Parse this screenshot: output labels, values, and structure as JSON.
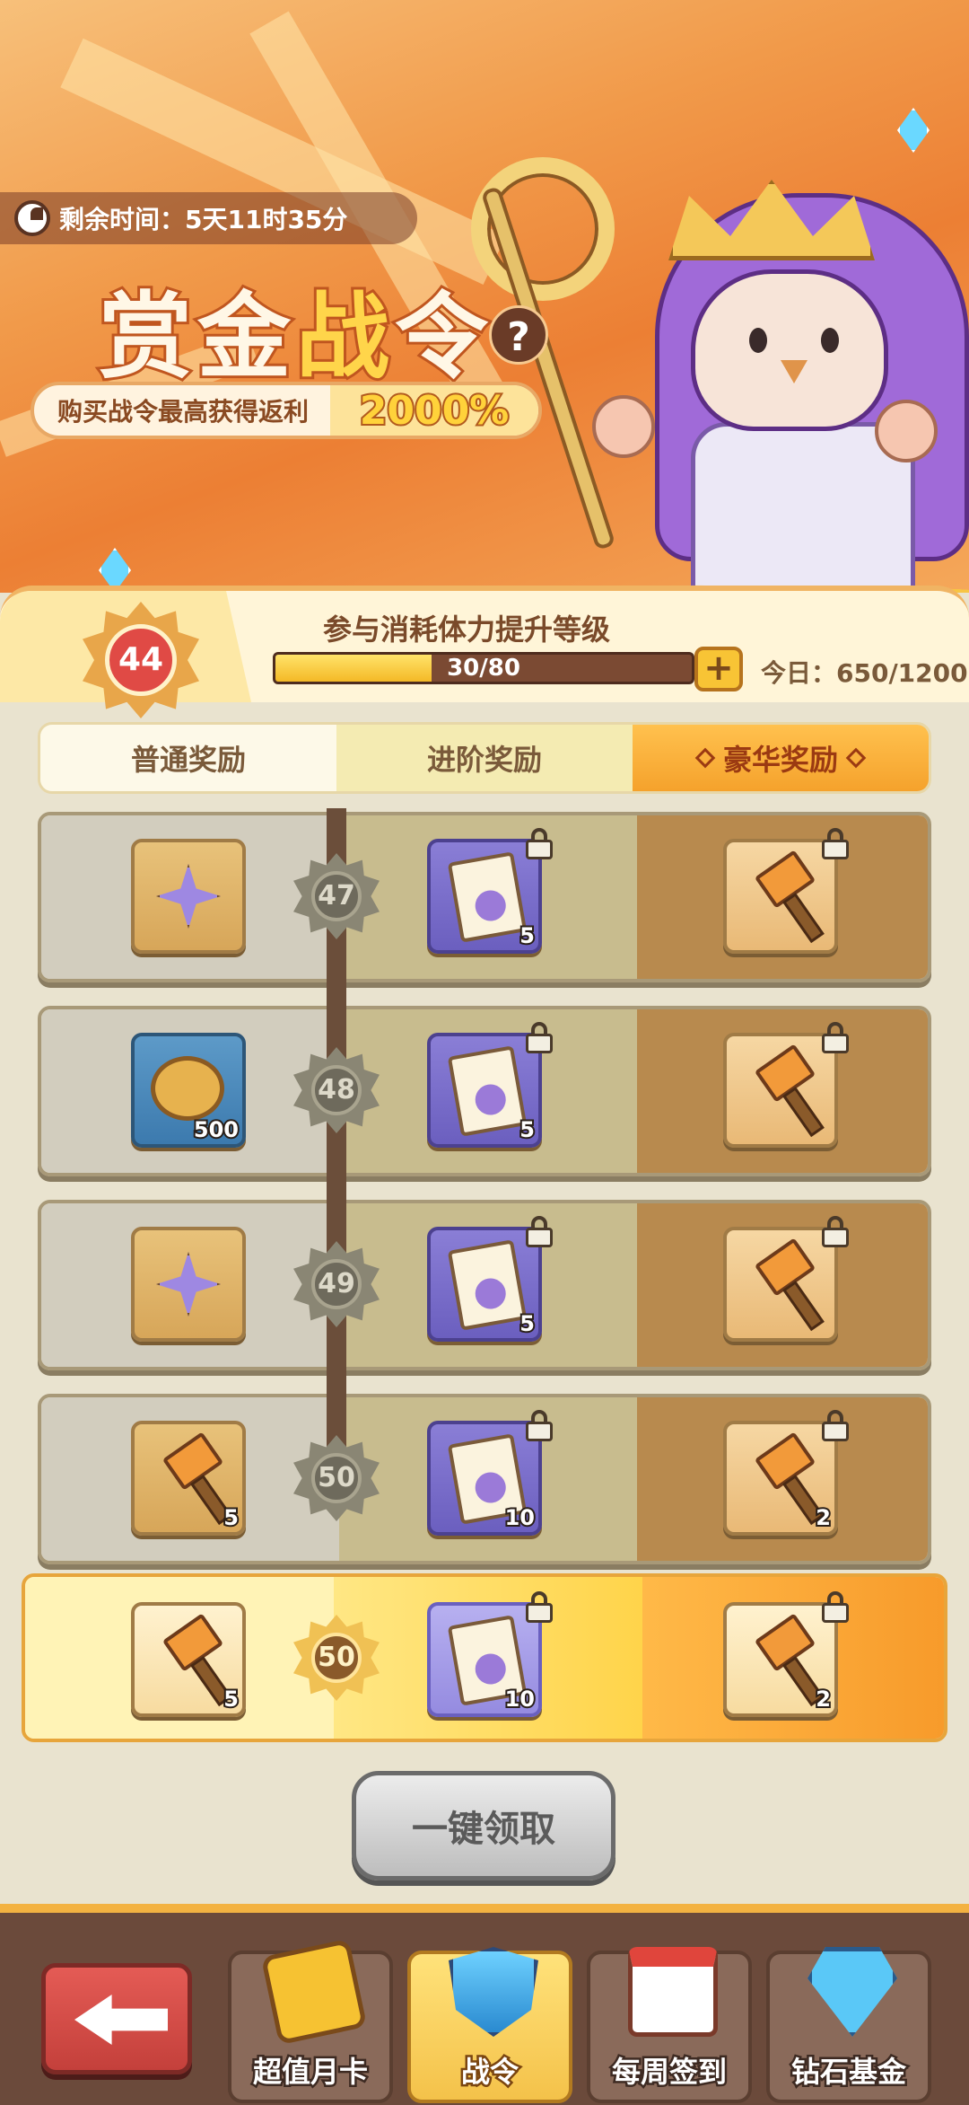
{
  "banner": {
    "timer_label": "剩余时间：5天11时35分",
    "title_part1": "赏金",
    "title_part2": "战",
    "title_part3": "令",
    "help_icon": "?",
    "promo_text": "购买战令最高获得返利",
    "promo_value": "2000%"
  },
  "level": {
    "current": "44",
    "hint": "参与消耗体力提升等级",
    "progress_text": "30/80",
    "progress_fraction": 0.375,
    "plus_label": "+",
    "today_text": "今日：650/1200"
  },
  "tabs": [
    {
      "label": "普通奖励"
    },
    {
      "label": "进阶奖励"
    },
    {
      "label": "豪华奖励"
    }
  ],
  "rows": [
    {
      "level": "47",
      "normal": {
        "icon": "star-crystal-icon",
        "count": ""
      },
      "advanced": {
        "icon": "integral-book-icon",
        "count": "5"
      },
      "deluxe": {
        "icon": "hammer-icon",
        "count": ""
      }
    },
    {
      "level": "48",
      "normal": {
        "icon": "gold-coin-icon",
        "count": "500"
      },
      "advanced": {
        "icon": "integral-book-icon",
        "count": "5"
      },
      "deluxe": {
        "icon": "hammer-icon",
        "count": ""
      }
    },
    {
      "level": "49",
      "normal": {
        "icon": "star-crystal-icon",
        "count": ""
      },
      "advanced": {
        "icon": "integral-book-icon",
        "count": "5"
      },
      "deluxe": {
        "icon": "hammer-icon",
        "count": ""
      }
    },
    {
      "level": "50",
      "normal": {
        "icon": "hammer-icon",
        "count": "5"
      },
      "advanced": {
        "icon": "integral-book-icon",
        "count": "10"
      },
      "deluxe": {
        "icon": "hammer-icon",
        "count": "2"
      }
    }
  ],
  "final_row": {
    "level": "50",
    "normal": {
      "icon": "hammer-icon",
      "count": "5"
    },
    "advanced": {
      "icon": "integral-book-icon",
      "count": "10"
    },
    "deluxe": {
      "icon": "hammer-icon",
      "count": "2"
    }
  },
  "claim_button": "一键领取",
  "bottom_nav": {
    "back_icon": "back-arrow-icon",
    "items": [
      {
        "label": "超值月卡",
        "icon": "month-card-icon"
      },
      {
        "label": "战令",
        "icon": "battle-pass-shield-icon"
      },
      {
        "label": "每周签到",
        "icon": "calendar-check-icon"
      },
      {
        "label": "钻石基金",
        "icon": "diamond-pile-icon"
      }
    ]
  }
}
